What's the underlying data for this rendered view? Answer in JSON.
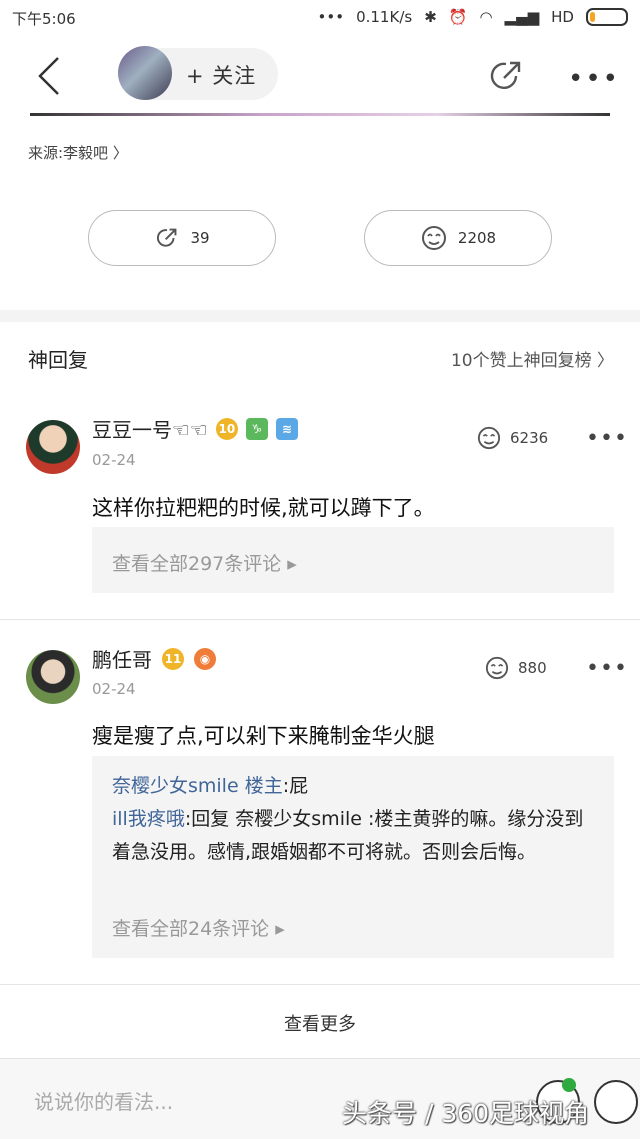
{
  "status_bar": {
    "time": "下午5:06",
    "network_speed": "0.11K/s",
    "hd_label": "HD",
    "battery_level": 0.15
  },
  "header": {
    "follow_label": "+ 关注"
  },
  "source": {
    "label": "来源:李毅吧 〉"
  },
  "stats": {
    "shares": "39",
    "likes": "2208"
  },
  "section": {
    "title": "神回复",
    "right_link": "10个赞上神回复榜 〉"
  },
  "comments": [
    {
      "name": "豆豆一号☜☜",
      "badge_level": "10",
      "date": "02-24",
      "likes": "6236",
      "text": "这样你拉粑粑的时候,就可以蹲下了。",
      "view_all": "查看全部297条评论 ▸"
    },
    {
      "name": "鹏任哥",
      "badge_level": "11",
      "date": "02-24",
      "likes": "880",
      "text": "瘦是瘦了点,可以剁下来腌制金华火腿",
      "replies": [
        {
          "author": "奈樱少女smile 楼主",
          "text": ":屁"
        },
        {
          "author": "ill我疼哦",
          "text": ":回复 奈樱少女smile :楼主黄骅的嘛。缘分没到着急没用。感情,跟婚姻都不可将就。否则会后悔。"
        }
      ],
      "view_all": "查看全部24条评论 ▸"
    }
  ],
  "more": {
    "label": "查看更多"
  },
  "input": {
    "placeholder": "说说你的看法..."
  },
  "watermark": {
    "text": "头条号 / 360足球视角"
  },
  "colors": {
    "accent_link": "#406599",
    "gold_badge": "#f0b429",
    "bg_gray": "#f4f4f4"
  }
}
